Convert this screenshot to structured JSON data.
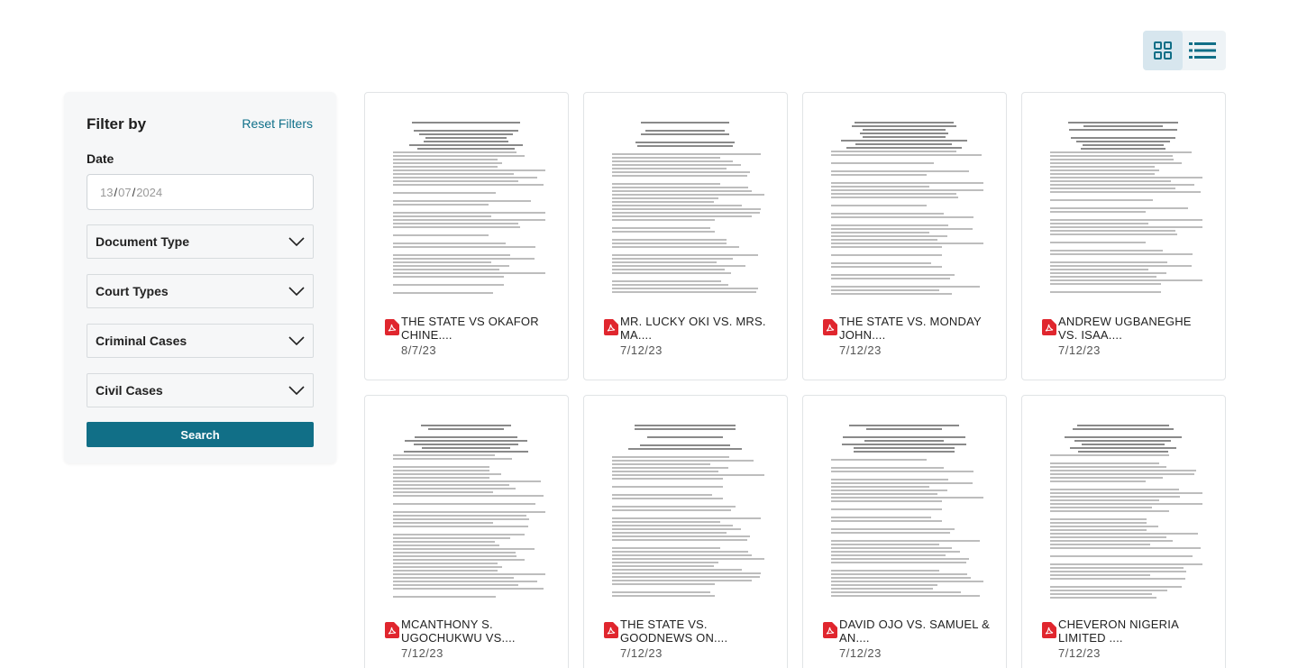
{
  "filters": {
    "title": "Filter by",
    "reset_label": "Reset Filters",
    "date_label": "Date",
    "date_value": {
      "day": "13",
      "month": "07",
      "year": "2024",
      "separator": "/"
    },
    "dropdowns": [
      {
        "label": "Document Type"
      },
      {
        "label": "Court Types"
      },
      {
        "label": "Criminal Cases"
      },
      {
        "label": "Civil Cases"
      }
    ],
    "search_label": "Search"
  },
  "view_toggle": {
    "active": "grid",
    "options": [
      "grid",
      "list"
    ]
  },
  "documents": [
    {
      "title": "THE STATE Vs OKAFOR CHINE....",
      "date": "8/7/23"
    },
    {
      "title": "MR. LUCKY OKI VS. MRS. MA....",
      "date": "7/12/23"
    },
    {
      "title": "THE STATE VS. MONDAY JOHN....",
      "date": "7/12/23"
    },
    {
      "title": "ANDREW UGBANEGHE VS. ISAA....",
      "date": "7/12/23"
    },
    {
      "title": "MCANTHONY S. UGOCHUKWU VS....",
      "date": "7/12/23"
    },
    {
      "title": "THE STATE VS. GOODNEWS ON....",
      "date": "7/12/23"
    },
    {
      "title": "DAVID OJO VS. SAMUEL & AN....",
      "date": "7/12/23"
    },
    {
      "title": "CHEVERON NIGERIA LIMITED ....",
      "date": "7/12/23"
    }
  ],
  "colors": {
    "accent": "#116f87",
    "pdf_red": "#e0262e",
    "panel_bg": "#f6f7f8"
  }
}
